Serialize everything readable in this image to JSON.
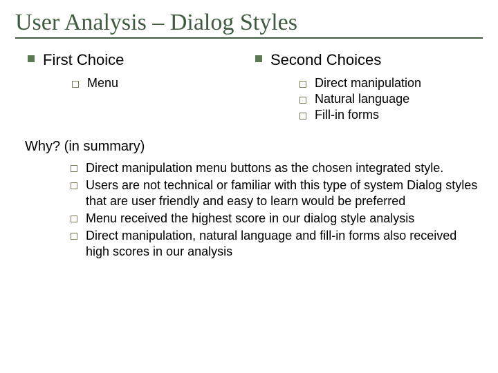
{
  "title": "User Analysis – Dialog Styles",
  "left": {
    "heading": "First Choice",
    "items": [
      "Menu"
    ]
  },
  "right": {
    "heading": "Second Choices",
    "items": [
      "Direct manipulation",
      "Natural language",
      "Fill-in forms"
    ]
  },
  "why_heading": "Why? (in summary)",
  "why_items": [
    "Direct manipulation menu buttons as the chosen integrated style.",
    "Users are not technical or familiar with this type of system\nDialog styles that are user friendly and easy to learn would be preferred",
    "Menu received the highest score in our dialog style analysis",
    "Direct manipulation, natural language and fill-in forms also received high scores in our analysis"
  ]
}
